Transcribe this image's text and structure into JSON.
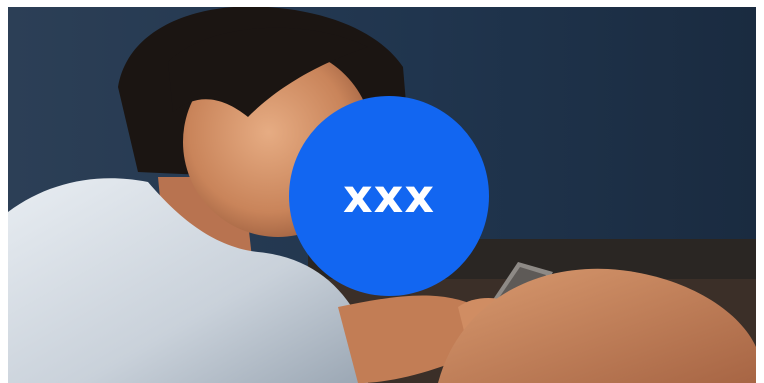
{
  "badge": {
    "text": "xxx",
    "color": "#1266f1"
  }
}
